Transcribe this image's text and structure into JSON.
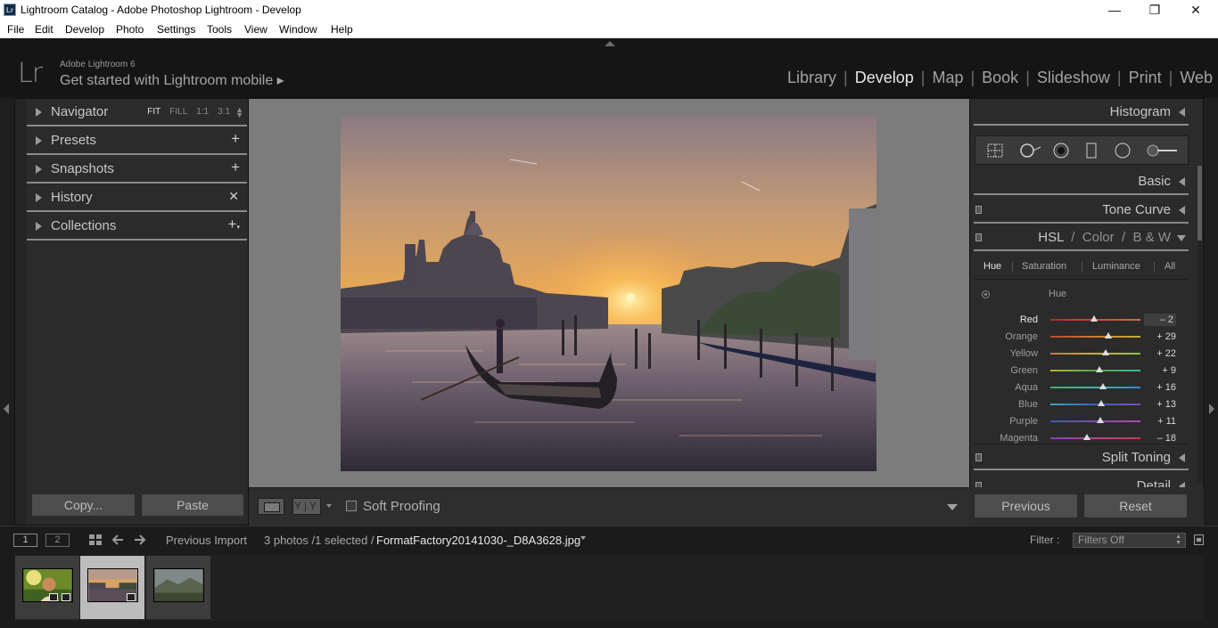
{
  "window": {
    "title": "Lightroom Catalog - Adobe Photoshop Lightroom - Develop",
    "icon": "Lr"
  },
  "menu": [
    "File",
    "Edit",
    "Develop",
    "Photo",
    "Settings",
    "Tools",
    "View",
    "Window",
    "Help"
  ],
  "identity": {
    "logo": "Lr",
    "version": "Adobe Lightroom 6",
    "mobile": "Get started with Lightroom mobile ▸"
  },
  "modules": [
    "Library",
    "Develop",
    "Map",
    "Book",
    "Slideshow",
    "Print",
    "Web"
  ],
  "active_module": "Develop",
  "left_panel": {
    "navigator": {
      "label": "Navigator",
      "zoom": [
        "FIT",
        "FILL",
        "1:1",
        "3:1"
      ],
      "active_zoom": "FIT"
    },
    "presets": "Presets",
    "snapshots": "Snapshots",
    "history": "History",
    "collections": "Collections",
    "copy_label": "Copy...",
    "paste_label": "Paste"
  },
  "toolbar": {
    "yy": "Y|Y",
    "soft_proofing": "Soft Proofing"
  },
  "right_panel": {
    "histogram": "Histogram",
    "basic": "Basic",
    "tone_curve": "Tone Curve",
    "hsl": {
      "hsl": "HSL",
      "color": "Color",
      "bw": "B & W",
      "slash": "/"
    },
    "tabs": [
      "Hue",
      "Saturation",
      "Luminance",
      "All"
    ],
    "active_tab": "Hue",
    "hue_title": "Hue",
    "sliders": [
      {
        "name": "Red",
        "value": "– 2",
        "num": -2,
        "colors": [
          "#b02c2c",
          "#d6403c",
          "#c8723a"
        ]
      },
      {
        "name": "Orange",
        "value": "+ 29",
        "num": 29,
        "colors": [
          "#b74a2f",
          "#cf7c33",
          "#c9ae3a"
        ]
      },
      {
        "name": "Yellow",
        "value": "+ 22",
        "num": 22,
        "colors": [
          "#c27a35",
          "#c8b23a",
          "#8fbf3f"
        ]
      },
      {
        "name": "Green",
        "value": "+ 9",
        "num": 9,
        "colors": [
          "#b4b33b",
          "#4faa47",
          "#3fb39a"
        ]
      },
      {
        "name": "Aqua",
        "value": "+ 16",
        "num": 16,
        "colors": [
          "#4aae52",
          "#3db5ae",
          "#3c84c4"
        ]
      },
      {
        "name": "Blue",
        "value": "+ 13",
        "num": 13,
        "colors": [
          "#3aa7b6",
          "#3d5fbf",
          "#7b4fb8"
        ]
      },
      {
        "name": "Purple",
        "value": "+ 11",
        "num": 11,
        "colors": [
          "#4058b8",
          "#7f4bb7",
          "#b448a6"
        ]
      },
      {
        "name": "Magenta",
        "value": "– 18",
        "num": -18,
        "colors": [
          "#7b45b5",
          "#b8428f",
          "#c23c4f"
        ]
      }
    ],
    "split_toning": "Split Toning",
    "detail": "Detail",
    "previous_label": "Previous",
    "reset_label": "Reset"
  },
  "filmstrip_bar": {
    "screen1": "1",
    "screen2": "2",
    "source": "Previous Import",
    "count": "3 photos /1 selected /",
    "filename": "FormatFactory20141030-_D8A3628.jpg",
    "filter_label": "Filter :",
    "filter_value": "Filters Off"
  },
  "colors": {
    "bg": "#2b2b2b",
    "accent": "#e8e8e8",
    "center": "#7c7c7c"
  }
}
